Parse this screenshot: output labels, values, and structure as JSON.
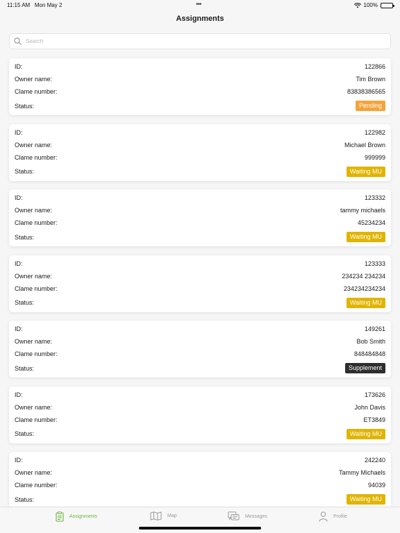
{
  "status_bar": {
    "time": "11:15 AM",
    "date": "Mon May 2",
    "battery": "100%"
  },
  "nav": {
    "title": "Assignments"
  },
  "search": {
    "placeholder": "Search"
  },
  "labels": {
    "id": "ID:",
    "owner": "Owner name:",
    "claim": "Clame number:",
    "status": "Status:"
  },
  "status_colors": {
    "Pending": "#f5a33a",
    "Waiting MU": "#e0b400",
    "Supplement": "#2e2e2e"
  },
  "assignments": [
    {
      "id": "122866",
      "owner": "Tim Brown",
      "claim": "83838386565",
      "status": "Pending"
    },
    {
      "id": "122982",
      "owner": "Michael Brown",
      "claim": "999999",
      "status": "Waiting MU"
    },
    {
      "id": "123332",
      "owner": "tammy michaels",
      "claim": "45234234",
      "status": "Waiting MU"
    },
    {
      "id": "123333",
      "owner": "234234 234234",
      "claim": "234234234234",
      "status": "Waiting MU"
    },
    {
      "id": "149261",
      "owner": "Bob Smith",
      "claim": "848484848",
      "status": "Supplement"
    },
    {
      "id": "173626",
      "owner": "John Davis",
      "claim": "ET3849",
      "status": "Waiting MU"
    },
    {
      "id": "242240",
      "owner": "Tammy Michaels",
      "claim": "94039",
      "status": "Waiting MU"
    }
  ],
  "tabs": [
    {
      "label": "Assignments",
      "icon": "clipboard-icon",
      "active": true
    },
    {
      "label": "Map",
      "icon": "map-icon",
      "active": false
    },
    {
      "label": "Messages",
      "icon": "messages-icon",
      "active": false
    },
    {
      "label": "Profile",
      "icon": "person-icon",
      "active": false
    }
  ],
  "accent": "#6db33f"
}
